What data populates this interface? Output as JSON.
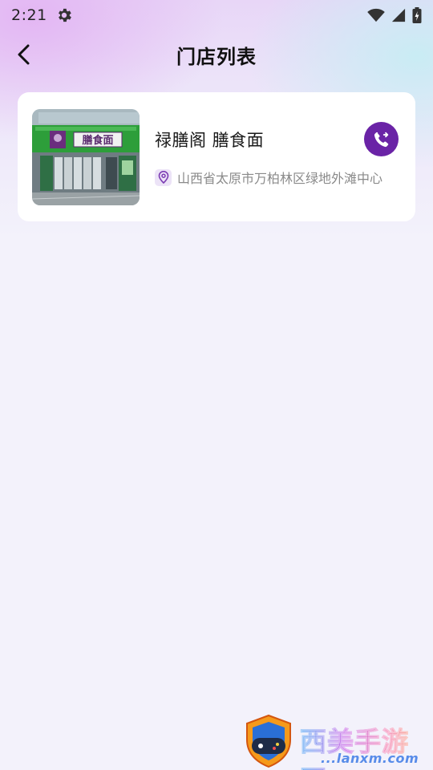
{
  "status_bar": {
    "time": "2:21",
    "icons": [
      "gear-icon",
      "wifi-icon",
      "signal-icon",
      "battery-icon"
    ]
  },
  "header": {
    "title": "门店列表",
    "back_icon": "chevron-left-icon"
  },
  "stores": [
    {
      "name": "禄膳阁 膳食面",
      "address": "山西省太原市万柏林区绿地外滩中心",
      "sign_text": "膳食面",
      "call_icon": "phone-call-icon",
      "location_icon": "map-pin-icon"
    }
  ],
  "watermark": {
    "text": "西美手游网",
    "url": "...lanxm.com"
  },
  "colors": {
    "accent": "#6a23a6",
    "background": "#f3f2fb",
    "card": "#ffffff",
    "address_text": "#8a8a8a"
  }
}
